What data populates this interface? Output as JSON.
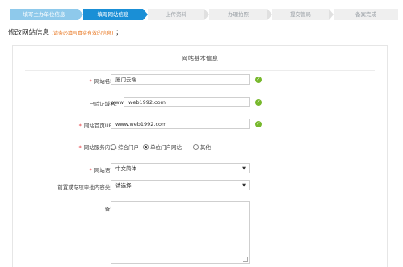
{
  "steps": [
    {
      "label": "填写主办单位信息",
      "state": "done"
    },
    {
      "label": "填写网站信息",
      "state": "active"
    },
    {
      "label": "上传资料",
      "state": "todo"
    },
    {
      "label": "办理拍照",
      "state": "todo"
    },
    {
      "label": "提交管局",
      "state": "todo"
    },
    {
      "label": "备案完成",
      "state": "todo"
    }
  ],
  "page": {
    "title": "修改网站信息",
    "note": "(请务必填写真实有效的信息)",
    "suffix": "；"
  },
  "panel": {
    "title": "网站基本信息"
  },
  "form": {
    "site_name": {
      "required": "*",
      "label": "网站名称:",
      "value": "厦门云端"
    },
    "domain": {
      "label": "已验证域名:",
      "prefix": "www.",
      "value": "web1992.com"
    },
    "homepage": {
      "required": "*",
      "label": "网站首页URL:",
      "value": "www.web1992.com"
    },
    "service": {
      "required": "*",
      "label": "网站服务内容:",
      "options": [
        "综合门户",
        "单位门户网站",
        "其他"
      ],
      "selected": "单位门户网站"
    },
    "language": {
      "required": "*",
      "label": "网站语言:",
      "value": "中文简体"
    },
    "approval": {
      "label": "前置或专项审批内容类型:",
      "value": "请选择"
    },
    "remark": {
      "label": "备注:",
      "value": ""
    }
  },
  "icons": {
    "valid": "check-circle-icon",
    "caret": "caret-down-icon"
  },
  "colors": {
    "step_done": "#8ec9eb",
    "step_active": "#1a8fd6",
    "step_todo": "#efefef",
    "required": "#e5343a",
    "note": "#e8741c",
    "valid": "#77b82c"
  }
}
